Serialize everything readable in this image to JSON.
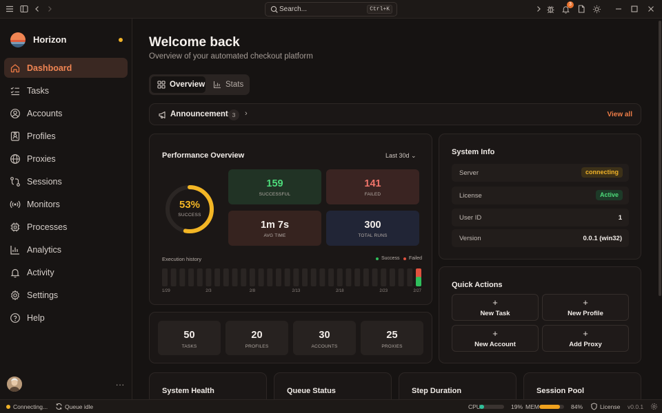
{
  "titlebar": {
    "search_placeholder": "Search...",
    "search_shortcut": "Ctrl+K",
    "notification_count": "3"
  },
  "sidebar": {
    "brand": "Horizon",
    "items": [
      {
        "label": "Dashboard",
        "icon": "home-icon",
        "active": true
      },
      {
        "label": "Tasks",
        "icon": "list-checks-icon"
      },
      {
        "label": "Accounts",
        "icon": "user-circle-icon"
      },
      {
        "label": "Profiles",
        "icon": "id-badge-icon"
      },
      {
        "label": "Proxies",
        "icon": "globe-icon"
      },
      {
        "label": "Sessions",
        "icon": "route-icon"
      },
      {
        "label": "Monitors",
        "icon": "radio-signal-icon"
      },
      {
        "label": "Processes",
        "icon": "cpu-icon"
      },
      {
        "label": "Analytics",
        "icon": "bar-chart-icon"
      },
      {
        "label": "Activity",
        "icon": "bell-icon"
      },
      {
        "label": "Settings",
        "icon": "gear-icon"
      },
      {
        "label": "Help",
        "icon": "help-circle-icon"
      }
    ],
    "more": "..."
  },
  "header": {
    "title": "Welcome back",
    "subtitle": "Overview of your automated checkout platform"
  },
  "tabs": [
    {
      "label": "Overview",
      "active": true
    },
    {
      "label": "Stats",
      "active": false
    }
  ],
  "announcements": {
    "title": "Announcements",
    "count": "3",
    "view_all": "View all"
  },
  "performance": {
    "title": "Performance Overview",
    "range": "Last 30d",
    "success_rate": "53%",
    "success_label": "SUCCESS",
    "success_fraction": 0.53,
    "tiles": [
      {
        "value": "159",
        "label": "SUCCESSFUL",
        "color": "#4ddb7a",
        "bg": "#213325"
      },
      {
        "value": "141",
        "label": "FAILED",
        "color": "#f0746a",
        "bg": "#3a2422"
      },
      {
        "value": "1m 7s",
        "label": "AVG TIME",
        "color": "#f3eeea",
        "bg": "#36231f"
      },
      {
        "value": "300",
        "label": "TOTAL RUNS",
        "color": "#f3eeea",
        "bg": "#212536"
      }
    ],
    "history": {
      "title": "Execution history",
      "legend_success": "Success",
      "legend_failed": "Failed",
      "success_color": "#2fbf5c",
      "failed_color": "#e0523f",
      "ticks": [
        "1/29",
        "2/3",
        "2/8",
        "2/13",
        "2/18",
        "2/23",
        "2/27"
      ],
      "last_day": {
        "success": 159,
        "failed": 141
      }
    }
  },
  "counts": [
    {
      "value": "50",
      "label": "TASKS"
    },
    {
      "value": "20",
      "label": "PROFILES"
    },
    {
      "value": "30",
      "label": "ACCOUNTS"
    },
    {
      "value": "25",
      "label": "PROXIES"
    }
  ],
  "system_info": {
    "title": "System Info",
    "rows": [
      {
        "key": "Server",
        "value": "connecting",
        "pill": "warn"
      },
      {
        "key": "License",
        "value": "Active",
        "pill": "ok"
      },
      {
        "key": "User ID",
        "value": "1"
      },
      {
        "key": "Version",
        "value": "0.0.1 (win32)"
      }
    ]
  },
  "quick_actions": {
    "title": "Quick Actions",
    "plus": "+",
    "buttons": [
      "New Task",
      "New Profile",
      "New Account",
      "Add Proxy"
    ]
  },
  "bottom_cards": [
    "System Health",
    "Queue Status",
    "Step Duration",
    "Session Pool"
  ],
  "statusbar": {
    "connection": "Connecting...",
    "queue": "Queue idle",
    "cpu_label": "CPU",
    "cpu_value": "19%",
    "cpu_fraction": 0.19,
    "mem_label": "MEM",
    "mem_value": "84%",
    "mem_fraction": 0.84,
    "license": "License",
    "version": "v0.0.1"
  },
  "colors": {
    "accent": "#ee7d47",
    "warning": "#f0b228",
    "success": "#4ddb7a",
    "danger": "#f0746a"
  }
}
